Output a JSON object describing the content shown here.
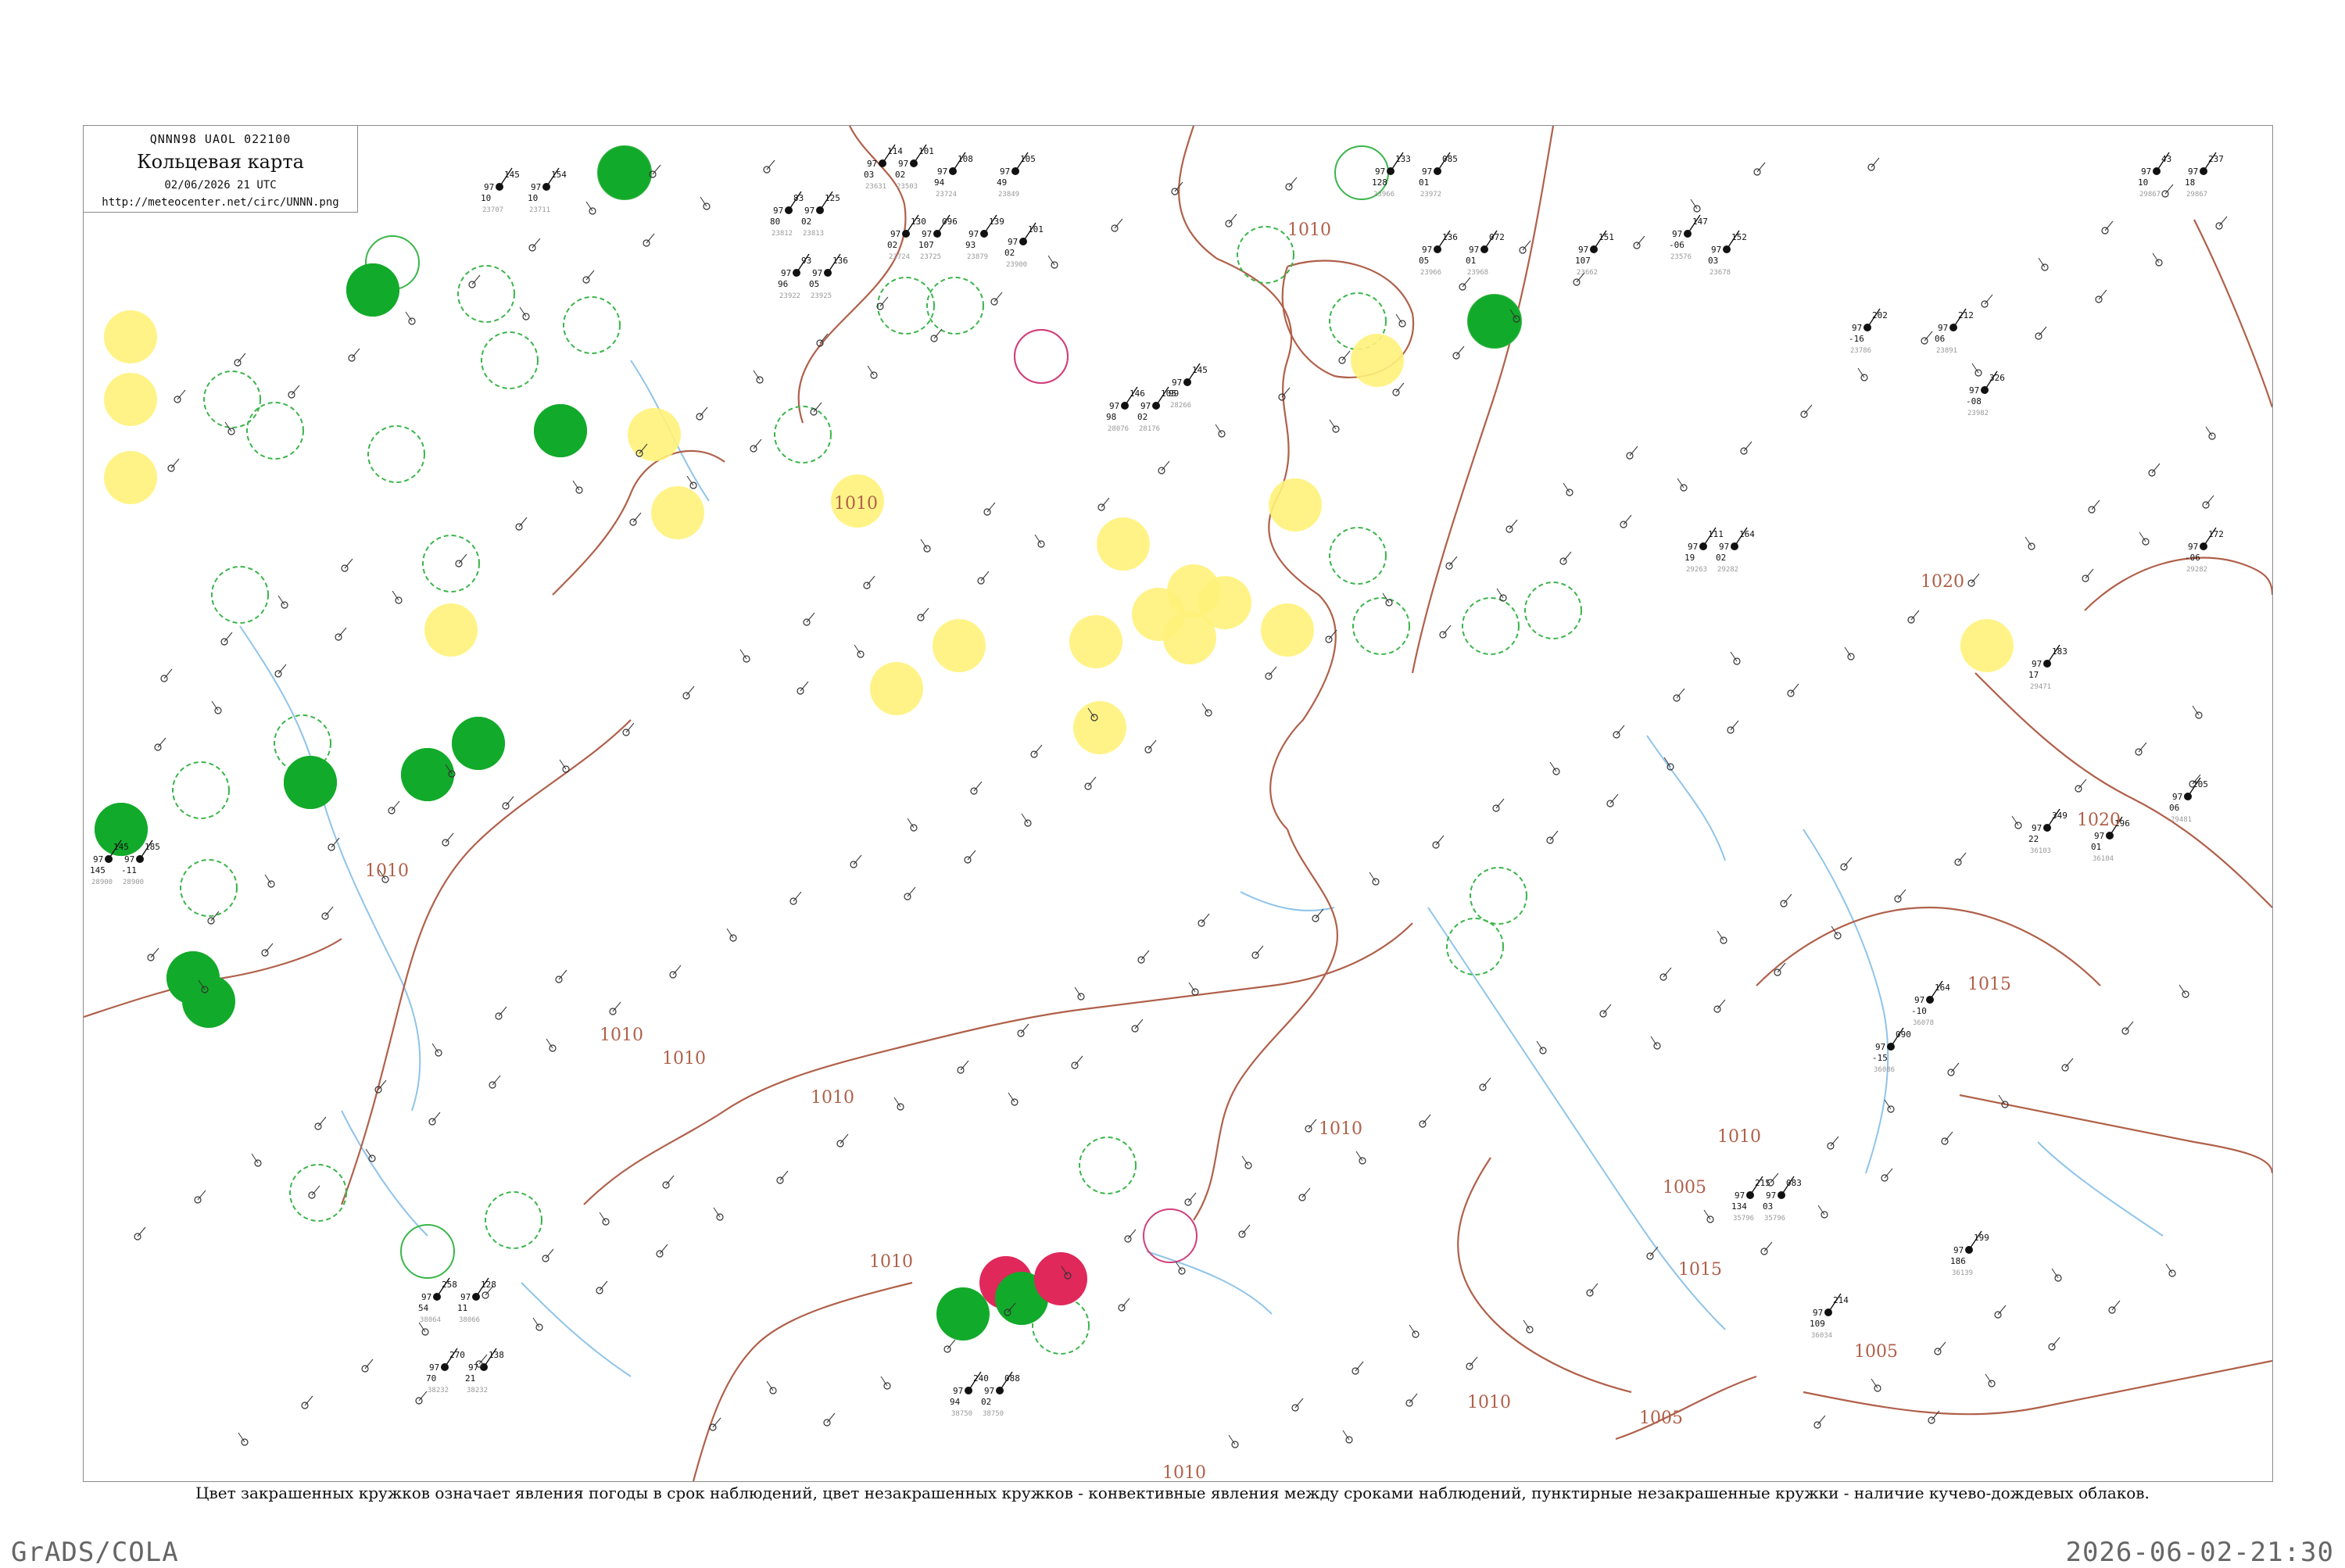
{
  "header": {
    "code": "QNNN98  UAOL  022100",
    "title": "Кольцевая карта",
    "datetime": "02/06/2026 21 UTC",
    "url": "http://meteocenter.net/circ/UNNN.png"
  },
  "legend_caption": "Цвет закрашенных кружков означает явления погоды в срок наблюдений, цвет незакрашенных кружков - конвективные явления между сроками наблюдений, пунктирные незакрашенные кружки - наличие кучево-дождевых облаков.",
  "footer": {
    "left": "GrADS/COLA",
    "right": "2026-06-02-21:30"
  },
  "colors": {
    "isobar": "#b0604a",
    "river": "#8fc4ea",
    "cb_ring": "#3ab54a",
    "rain": "#2fbf2f",
    "shower": "#12aa2a",
    "haze": "#fff27a",
    "light_rain": "#5fe08a",
    "thunder": "#e0285a",
    "storm_ring": "#d0407a"
  },
  "isobar_labels": [
    "1010",
    "1010",
    "1010",
    "1010",
    "1010",
    "1010",
    "1010",
    "1010",
    "1010",
    "1020",
    "1020",
    "1015",
    "1015",
    "1005",
    "1005",
    "1005",
    "1010",
    "1010"
  ],
  "stations": [
    {
      "p": "145",
      "t": "97",
      "d": "10",
      "id": "23707"
    },
    {
      "p": "154",
      "t": "97",
      "d": "10",
      "id": "23711"
    },
    {
      "p": "114",
      "t": "97",
      "d": "03",
      "id": "23631"
    },
    {
      "p": "101",
      "t": "97",
      "d": "02",
      "id": "23503"
    },
    {
      "p": "108",
      "t": "97",
      "d": "94",
      "id": "23724"
    },
    {
      "p": "105",
      "t": "97",
      "d": "49",
      "id": "23849"
    },
    {
      "p": "139",
      "t": "97",
      "d": "93",
      "id": "23879"
    },
    {
      "p": "101",
      "t": "97",
      "d": "02",
      "id": "23900"
    },
    {
      "p": "83",
      "t": "97",
      "d": "80",
      "id": "23812"
    },
    {
      "p": "125",
      "t": "97",
      "d": "02",
      "id": "23813"
    },
    {
      "p": "130",
      "t": "97",
      "d": "02",
      "id": "23724"
    },
    {
      "p": "096",
      "t": "97",
      "d": "107",
      "id": "23725"
    },
    {
      "p": "93",
      "t": "97",
      "d": "96",
      "id": "23922"
    },
    {
      "p": "136",
      "t": "97",
      "d": "05",
      "id": "23925"
    },
    {
      "p": "146",
      "t": "97",
      "d": "98",
      "id": "28076"
    },
    {
      "p": "105",
      "t": "97",
      "d": "02",
      "id": "28176"
    },
    {
      "p": "145",
      "t": "97",
      "d": "99",
      "id": "28266"
    },
    {
      "p": "133",
      "t": "97",
      "d": "128",
      "id": "23966"
    },
    {
      "p": "085",
      "t": "97",
      "d": "01",
      "id": "23972"
    },
    {
      "p": "136",
      "t": "97",
      "d": "05",
      "id": "23966"
    },
    {
      "p": "072",
      "t": "97",
      "d": "01",
      "id": "23968"
    },
    {
      "p": "151",
      "t": "97",
      "d": "107",
      "id": "23662"
    },
    {
      "p": "147",
      "t": "97",
      "d": "-06",
      "id": "23576"
    },
    {
      "p": "152",
      "t": "97",
      "d": "03",
      "id": "23678"
    },
    {
      "p": "202",
      "t": "97",
      "d": "-16",
      "id": "23786"
    },
    {
      "p": "43",
      "t": "97",
      "d": "10",
      "id": "29867"
    },
    {
      "p": "237",
      "t": "97",
      "d": "18",
      "id": "29867"
    },
    {
      "p": "212",
      "t": "97",
      "d": "06",
      "id": "23891"
    },
    {
      "p": "326",
      "t": "97",
      "d": "-08",
      "id": "23982"
    },
    {
      "p": "111",
      "t": "97",
      "d": "19",
      "id": "29263"
    },
    {
      "p": "164",
      "t": "97",
      "d": "02",
      "id": "29282"
    },
    {
      "p": "172",
      "t": "97",
      "d": "-06",
      "id": "29282"
    },
    {
      "p": "183",
      "t": "97",
      "d": "17",
      "id": "29471"
    },
    {
      "p": "205",
      "t": "97",
      "d": "06",
      "id": "29481"
    },
    {
      "p": "349",
      "t": "97",
      "d": "22",
      "id": "36103"
    },
    {
      "p": "196",
      "t": "97",
      "d": "01",
      "id": "36104"
    },
    {
      "p": "164",
      "t": "97",
      "d": "-10",
      "id": "36078"
    },
    {
      "p": "090",
      "t": "97",
      "d": "-15",
      "id": "36086"
    },
    {
      "p": "199",
      "t": "97",
      "d": "186",
      "id": "36139"
    },
    {
      "p": "214",
      "t": "97",
      "d": "109",
      "id": "36034"
    },
    {
      "p": "215",
      "t": "97",
      "d": "134",
      "id": "35796"
    },
    {
      "p": "083",
      "t": "97",
      "d": "03",
      "id": "35796"
    },
    {
      "p": "258",
      "t": "97",
      "d": "54",
      "id": "38064"
    },
    {
      "p": "128",
      "t": "97",
      "d": "11",
      "id": "38066"
    },
    {
      "p": "270",
      "t": "97",
      "d": "70",
      "id": "38232"
    },
    {
      "p": "138",
      "t": "97",
      "d": "21",
      "id": "38232"
    },
    {
      "p": "240",
      "t": "97",
      "d": "94",
      "id": "38750"
    },
    {
      "p": "088",
      "t": "97",
      "d": "02",
      "id": "38750"
    },
    {
      "p": "145",
      "t": "97",
      "d": "145",
      "id": "28900"
    },
    {
      "p": "185",
      "t": "97",
      "d": "-11",
      "id": "28900"
    }
  ]
}
